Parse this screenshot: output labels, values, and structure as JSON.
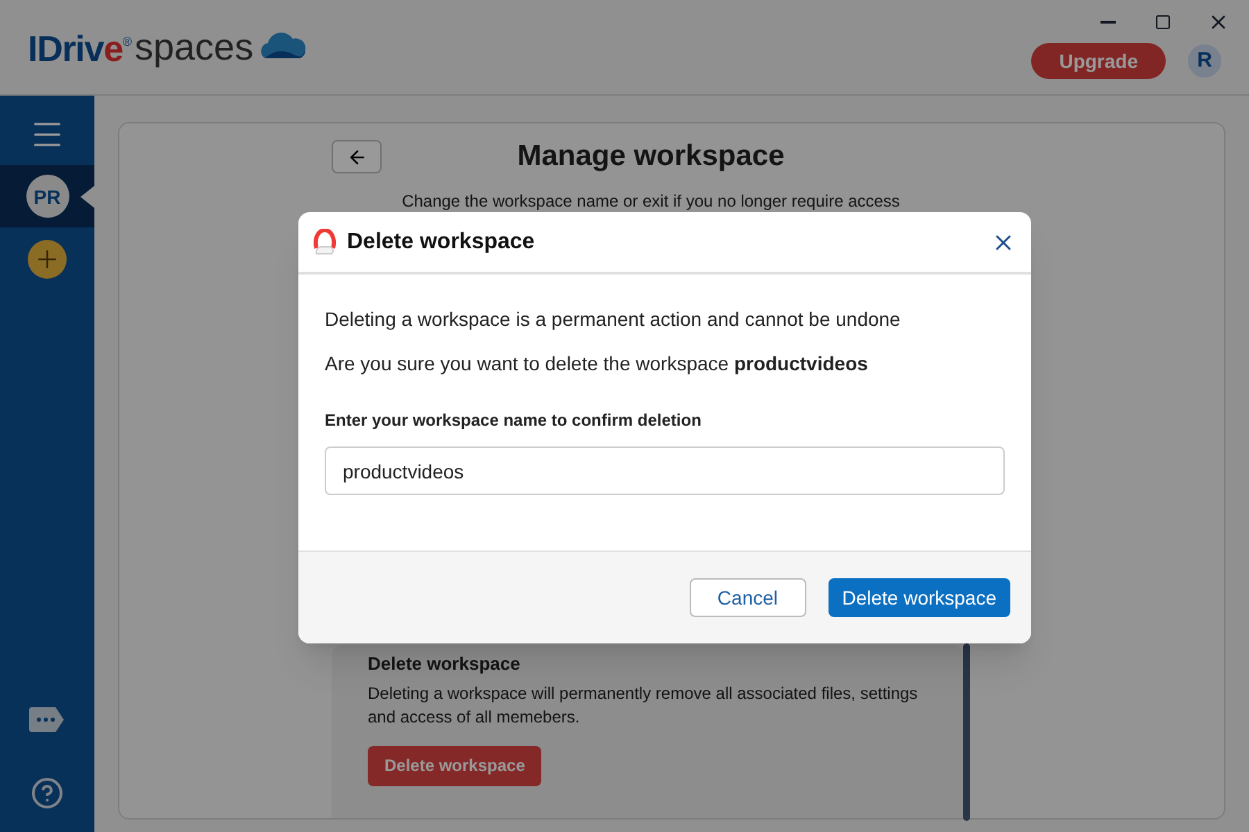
{
  "window": {
    "controls": [
      {
        "kind": "minimize"
      },
      {
        "kind": "maximize"
      },
      {
        "kind": "close"
      }
    ]
  },
  "logo": {
    "brand_start": "IDriv",
    "brand_accent": "e",
    "registered": "®",
    "product": "spaces"
  },
  "header": {
    "upgrade_button": "Upgrade",
    "avatar": "R"
  },
  "sidebar": {
    "items": [
      {
        "kind": "menu",
        "selected": false
      },
      {
        "kind": "workspace",
        "label": "PR",
        "selected": true
      },
      {
        "kind": "add",
        "selected": false
      }
    ],
    "bottom_items": [
      {
        "kind": "chat"
      },
      {
        "kind": "help"
      }
    ]
  },
  "page": {
    "title": "Manage workspace",
    "subtitle": "Change the workspace name or exit if you no longer require access",
    "delete_section": {
      "heading": "Delete workspace",
      "description": "Deleting a workspace will permanently remove all associated files, settings and access of all memebers.",
      "button": "Delete workspace"
    }
  },
  "dialog": {
    "title": "Delete workspace",
    "message": "Deleting a workspace is a permanent action and cannot be undone",
    "question": "Are you sure you want to delete the workspace **productvideos**",
    "field_label": "Enter your workspace name to confirm deletion",
    "field_value": "productvideos",
    "buttons": [
      {
        "kind": "secondary",
        "label": "Cancel"
      },
      {
        "kind": "primary",
        "label": "Delete workspace"
      }
    ]
  }
}
